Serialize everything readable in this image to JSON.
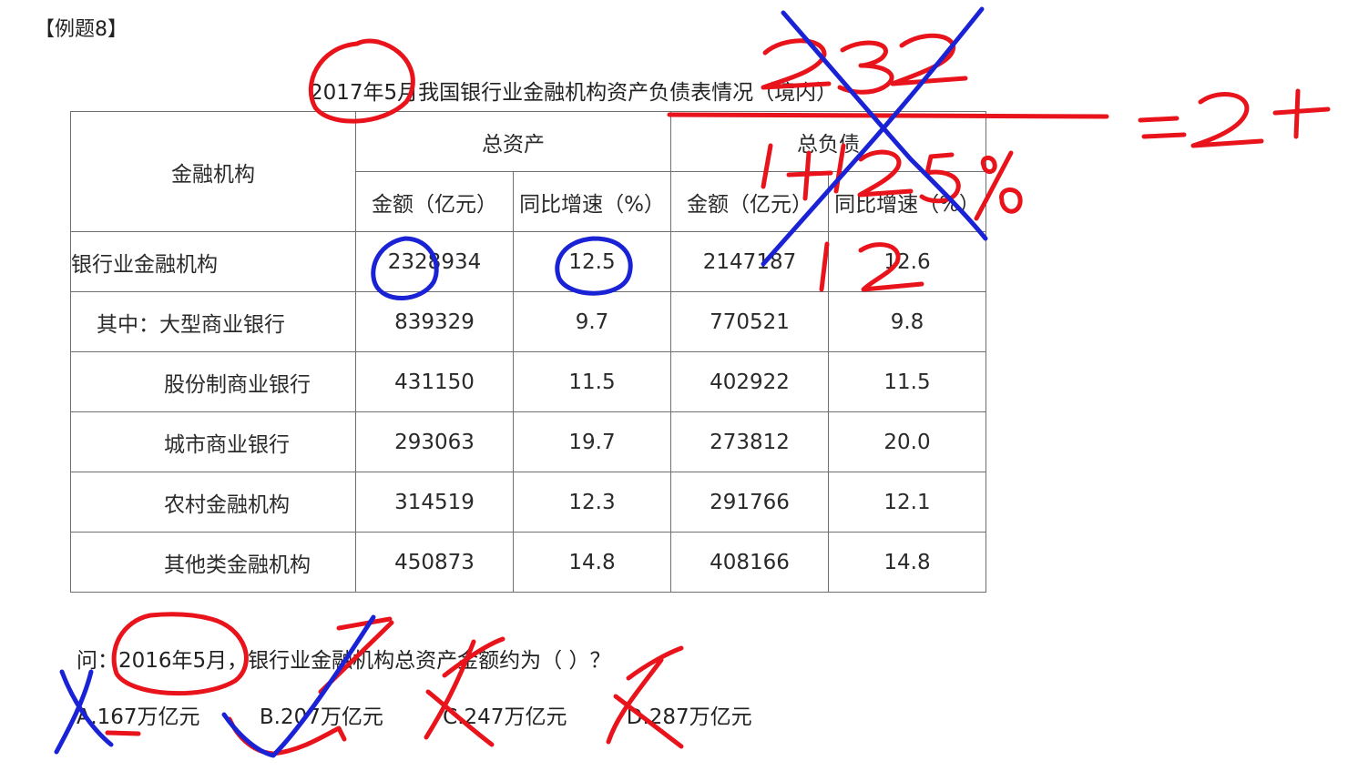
{
  "label": "【例题8】",
  "table": {
    "title": "2017年5月我国银行业金融机构资产负债表情况（境内）",
    "row_header": "金融机构",
    "group_headers": [
      "总资产",
      "总负债"
    ],
    "sub_headers": [
      "金额（亿元）",
      "同比增速（%）",
      "金额（亿元）",
      "同比增速（%）"
    ],
    "rows": [
      {
        "name": "银行业金融机构",
        "cells": [
          "2328934",
          "12.5",
          "2147187",
          "12.6"
        ]
      },
      {
        "name": "其中：大型商业银行",
        "cells": [
          "839329",
          "9.7",
          "770521",
          "9.8"
        ]
      },
      {
        "name": "股份制商业银行",
        "cells": [
          "431150",
          "11.5",
          "402922",
          "11.5"
        ]
      },
      {
        "name": "城市商业银行",
        "cells": [
          "293063",
          "19.7",
          "273812",
          "20.0"
        ]
      },
      {
        "name": "农村金融机构",
        "cells": [
          "314519",
          "12.3",
          "291766",
          "12.1"
        ]
      },
      {
        "name": "其他类金融机构",
        "cells": [
          "450873",
          "14.8",
          "408166",
          "14.8"
        ]
      }
    ]
  },
  "question": "问：2016年5月，银行业金融机构总资产金额约为（   ）？",
  "options": [
    "A.167万亿元",
    "B.207万亿元",
    "C.247万亿元",
    "D.287万亿元"
  ],
  "annotations": {
    "numerator": "232",
    "denominator": "1+12.5%",
    "result": "=2+",
    "small_note": "12",
    "ink_colors": {
      "red": "#e8131b",
      "blue": "#1a22d6"
    }
  }
}
